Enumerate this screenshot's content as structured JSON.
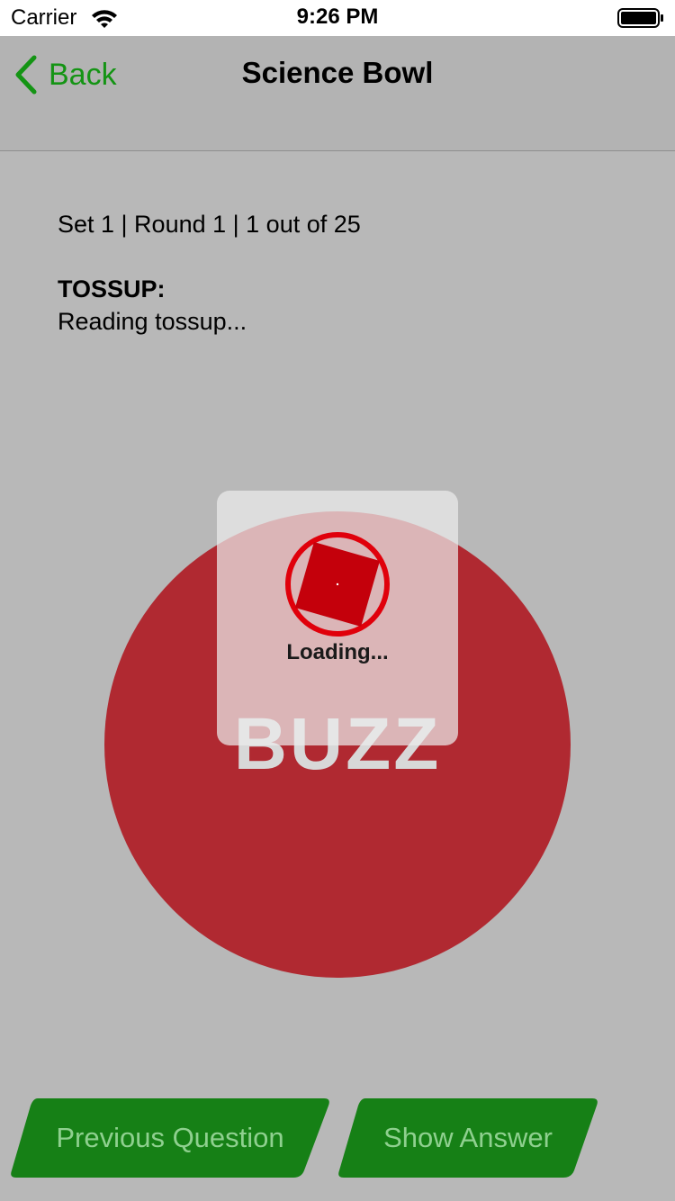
{
  "status_bar": {
    "carrier": "Carrier",
    "time": "9:26 PM",
    "icons": [
      "wifi-icon",
      "battery-icon"
    ]
  },
  "nav": {
    "back_label": "Back",
    "title": "Science Bowl"
  },
  "question": {
    "meta": "Set 1 | Round 1 | 1 out of 25",
    "type_label": "TOSSUP:",
    "text": "Reading tossup..."
  },
  "buzz": {
    "label": "BUZZ"
  },
  "loading": {
    "text": "Loading..."
  },
  "buttons": {
    "previous_label": "Previous Question",
    "show_answer_label": "Show Answer"
  },
  "colors": {
    "accent_green": "#149414",
    "button_green": "#168016",
    "buzz_red": "#b02931",
    "spinner_red": "#e0000b",
    "background_gray": "#b8b8b8"
  }
}
